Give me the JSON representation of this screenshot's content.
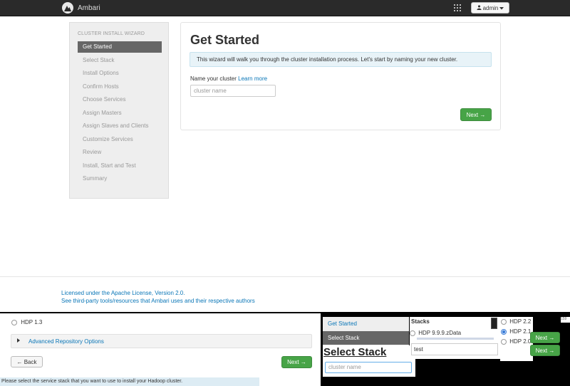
{
  "topbar": {
    "brand": "Ambari",
    "user_label": "admin",
    "user_icon": "user-icon",
    "caret_icon": "caret-down-icon",
    "apps_icon": "grid-icon"
  },
  "sidebar": {
    "title": "CLUSTER INSTALL WIZARD",
    "steps": [
      {
        "label": "Get Started",
        "active": true
      },
      {
        "label": "Select Stack"
      },
      {
        "label": "Install Options"
      },
      {
        "label": "Confirm Hosts"
      },
      {
        "label": "Choose Services"
      },
      {
        "label": "Assign Masters"
      },
      {
        "label": "Assign Slaves and Clients"
      },
      {
        "label": "Customize Services"
      },
      {
        "label": "Review"
      },
      {
        "label": "Install, Start and Test"
      },
      {
        "label": "Summary"
      }
    ]
  },
  "main": {
    "title": "Get Started",
    "info": "This wizard will walk you through the cluster installation process. Let's start by naming your new cluster.",
    "name_label": "Name your cluster",
    "learn_more": "Learn more",
    "name_placeholder": "cluster name",
    "next_label": "Next →"
  },
  "footer": {
    "license": "Licensed under the Apache License, Version 2.0.",
    "third_party": "See third-party tools/resources that Ambari uses and their respective authors"
  },
  "fragments": {
    "hdp13": "HDP 1.3",
    "advanced_repo": "Advanced Repository Options",
    "back_label": "← Back",
    "next_label": "Next →",
    "status": "Please select the service stack that you want to use to install your Hadoop cluster.",
    "steps_get_started": "Get Started",
    "steps_select_stack": "Select Stack",
    "select_stack_title": "Select Stack",
    "cluster_placeholder": "cluster name",
    "stacks_label": "Stacks",
    "stack_option": "HDP 9.9.9.zData",
    "stack_input_value": "test",
    "hdp_options": [
      {
        "label": "HDP 2.2",
        "selected": false
      },
      {
        "label": "HDP 2.1",
        "selected": true
      },
      {
        "label": "HDP 2.0",
        "selected": false
      }
    ],
    "next_r1": "Next →",
    "next_r2": "Next →",
    "corner": "159"
  },
  "colors": {
    "accent": "#0a76b7",
    "success": "#47a447",
    "topbar": "#2a2a2a"
  }
}
